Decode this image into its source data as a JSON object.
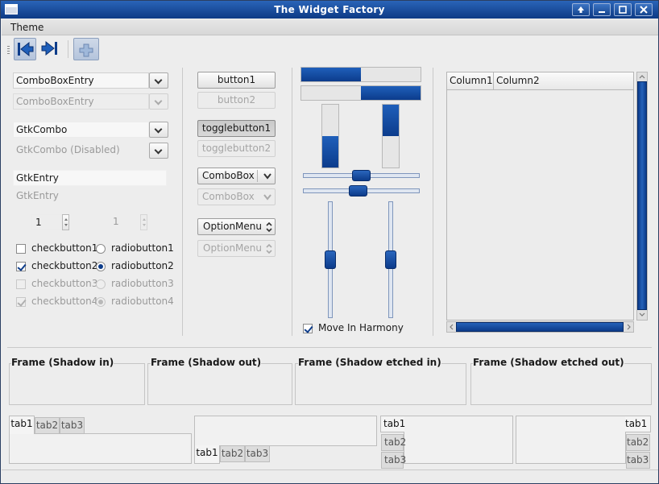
{
  "window": {
    "title": "The Widget Factory"
  },
  "menu": {
    "theme": "Theme"
  },
  "combos": {
    "entry1": "ComboBoxEntry",
    "entry2": "ComboBoxEntry",
    "gtkcombo": "GtkCombo",
    "gtkcombo_dis": "GtkCombo (Disabled)"
  },
  "entries": {
    "entry1": "GtkEntry",
    "entry2": "GtkEntry"
  },
  "spins": {
    "spin1": "1",
    "spin2": "1"
  },
  "checks": [
    "checkbutton1",
    "checkbutton2",
    "checkbutton3",
    "checkbutton4"
  ],
  "radios": [
    "radiobutton1",
    "radiobutton2",
    "radiobutton3",
    "radiobutton4"
  ],
  "buttons": {
    "button1": "button1",
    "button2": "button2",
    "toggle1": "togglebutton1",
    "toggle2": "togglebutton2",
    "combobox1": "ComboBox",
    "combobox2": "ComboBox",
    "option1": "OptionMenu",
    "option2": "OptionMenu"
  },
  "progress": {
    "h1": 0.5,
    "h2": 0.5,
    "v1": 0.5,
    "v2": 0.5
  },
  "scales": {
    "h1": 0.5,
    "h2": 0.5,
    "v1": 0.5,
    "v2": 0.5
  },
  "harmony": {
    "label": "Move In Harmony",
    "checked": true
  },
  "tree": {
    "columns": [
      "Column1",
      "Column2"
    ]
  },
  "frames": [
    "Frame (Shadow in)",
    "Frame (Shadow out)",
    "Frame (Shadow etched in)",
    "Frame (Shadow etched out)"
  ],
  "tabs": [
    "tab1",
    "tab2",
    "tab3"
  ],
  "colors": {
    "accent": "#0d3c8a",
    "titlebar": "#1a4da0",
    "background": "#ededed"
  }
}
